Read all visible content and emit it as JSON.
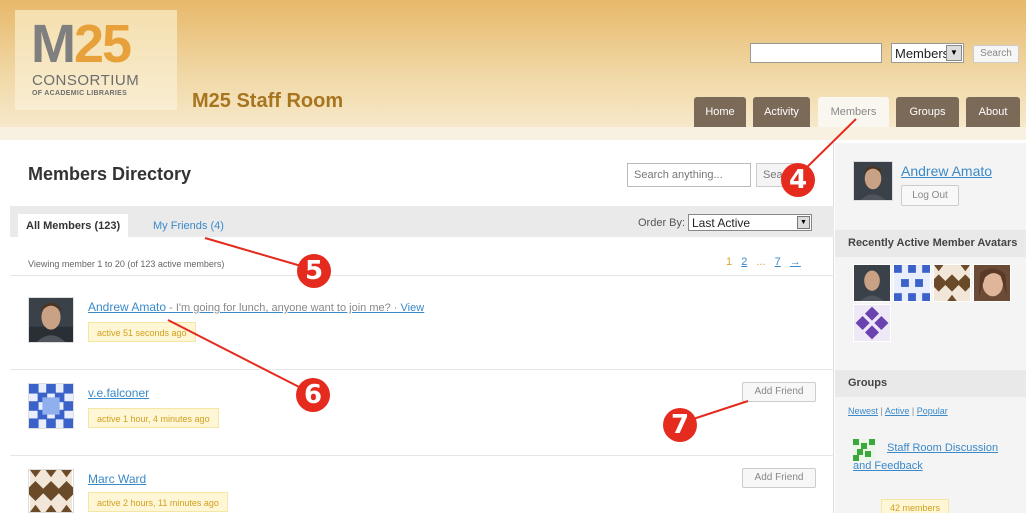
{
  "header": {
    "logo_m": "M",
    "logo_25": "25",
    "logo_line1": "CONSORTIUM",
    "logo_line2": "OF ACADEMIC LIBRARIES",
    "site_title": "M25 Staff Room",
    "search_value": "",
    "search_scope": "Members",
    "search_button": "Search",
    "nav": [
      {
        "label": "Home"
      },
      {
        "label": "Activity"
      },
      {
        "label": "Members"
      },
      {
        "label": "Groups"
      },
      {
        "label": "About"
      }
    ]
  },
  "directory": {
    "title": "Members Directory",
    "search_placeholder": "Search anything...",
    "search_button": "Search",
    "tabs": [
      {
        "label": "All Members (123)"
      },
      {
        "label": "My Friends (4)"
      }
    ],
    "order_by_label": "Order By:",
    "order_by_value": "Last Active",
    "viewing_text": "Viewing member 1 to 20 (of 123 active members)",
    "pagination": [
      "1",
      "2",
      "...",
      "7",
      "→"
    ],
    "members": [
      {
        "name": "Andrew Amato",
        "status": " - I'm going for lunch, anyone want to join me? · ",
        "view": "View",
        "active": "active 51 seconds ago",
        "avatar": "photo"
      },
      {
        "name": "v.e.falconer",
        "active": "active 1 hour, 4 minutes ago",
        "add_friend": "Add Friend",
        "avatar": "blue-pattern"
      },
      {
        "name": "Marc Ward",
        "active": "active 2 hours, 11 minutes ago",
        "add_friend": "Add Friend",
        "avatar": "brown-pattern"
      }
    ]
  },
  "sidebar": {
    "user_name": "Andrew Amato",
    "logout_label": "Log Out",
    "recent_heading": "Recently Active Member Avatars",
    "groups_heading": "Groups",
    "group_filters": [
      "Newest",
      "Active",
      "Popular"
    ],
    "group_filter_sep": " | ",
    "group_name": "Staff Room Discussion and Feedback",
    "group_members": "42 members"
  },
  "annotations": [
    "4",
    "5",
    "6",
    "7"
  ],
  "colors": {
    "link": "#3a89c9",
    "nav_dark": "#7b6a58",
    "badge": "#e52a1e",
    "active_bg": "#fef6d4"
  }
}
